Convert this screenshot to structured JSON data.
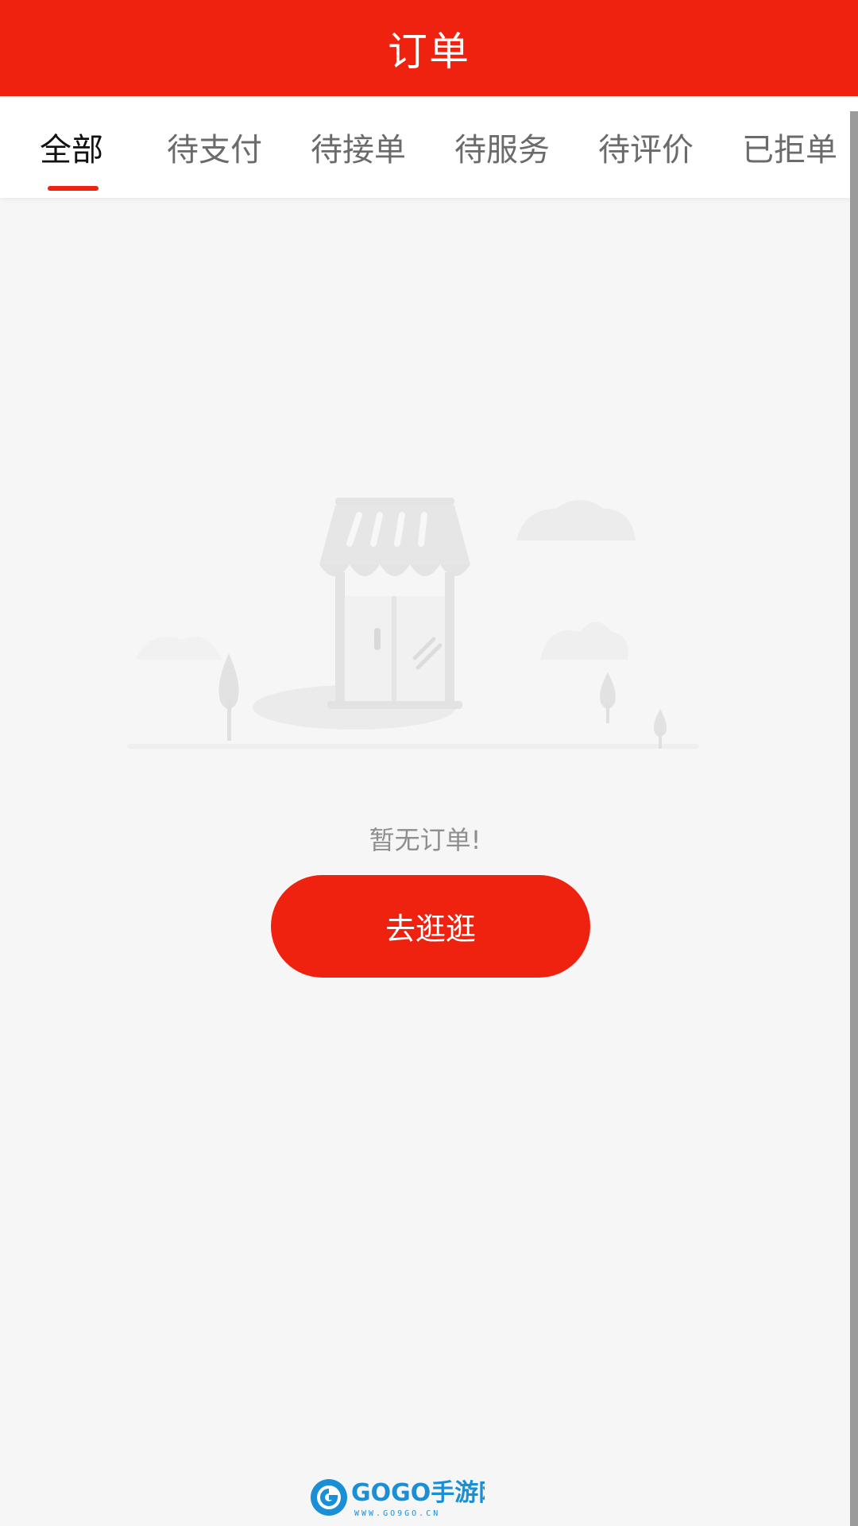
{
  "colors": {
    "brand": "#ee220f"
  },
  "header": {
    "title": "订单"
  },
  "tabs": [
    {
      "label": "全部",
      "active": true
    },
    {
      "label": "待支付",
      "active": false
    },
    {
      "label": "待接单",
      "active": false
    },
    {
      "label": "待服务",
      "active": false
    },
    {
      "label": "待评价",
      "active": false
    },
    {
      "label": "已拒单",
      "active": false
    }
  ],
  "empty_state": {
    "icon": "storefront-illustration",
    "message": "暂无订单!",
    "button_label": "去逛逛"
  },
  "watermark": {
    "brand": "GOGO手游网",
    "url": "WWW.GO9GO.CN"
  }
}
